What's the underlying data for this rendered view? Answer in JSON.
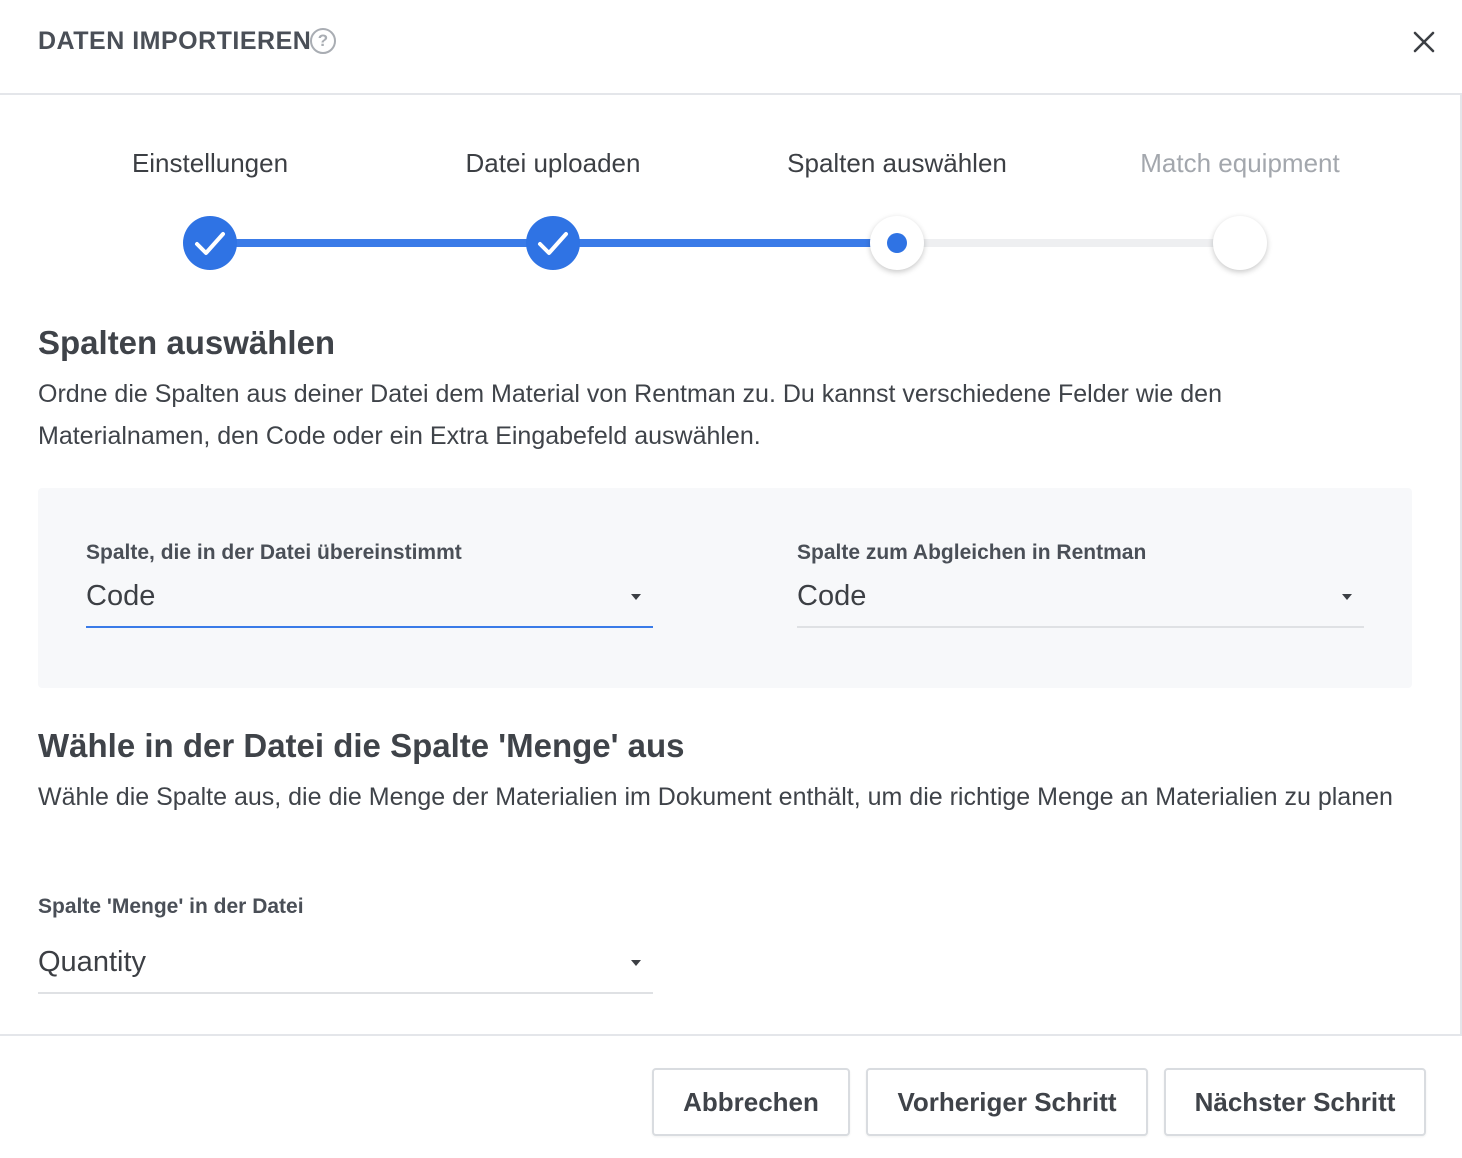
{
  "header": {
    "title": "DATEN IMPORTIEREN",
    "help_icon": "question-circle-icon",
    "help_glyph": "?",
    "close_icon": "close-icon"
  },
  "stepper": {
    "steps": [
      {
        "label": "Einstellungen",
        "state": "done"
      },
      {
        "label": "Datei uploaden",
        "state": "done"
      },
      {
        "label": "Spalten auswählen",
        "state": "current"
      },
      {
        "label": "Match equipment",
        "state": "todo"
      }
    ]
  },
  "section_columns": {
    "heading": "Spalten auswählen",
    "description": "Ordne die Spalten aus deiner Datei dem Material von Rentman zu. Du kannst verschiedene Felder wie den Materialnamen, den Code oder ein Extra Eingabefeld auswählen.",
    "file_column": {
      "label": "Spalte, die in der Datei übereinstimmt",
      "value": "Code"
    },
    "rentman_column": {
      "label": "Spalte zum Abgleichen in Rentman",
      "value": "Code"
    }
  },
  "section_quantity": {
    "heading": "Wähle in der Datei die Spalte 'Menge' aus",
    "description": "Wähle die Spalte aus, die die Menge der Materialien im Dokument enthält, um die richtige Menge an Materialien zu planen",
    "quantity_column": {
      "label": "Spalte 'Menge' in der Datei",
      "value": "Quantity"
    }
  },
  "footer": {
    "cancel_label": "Abbrechen",
    "previous_label": "Vorheriger Schritt",
    "next_label": "Nächster Schritt"
  },
  "colors": {
    "accent": "#2f73e4",
    "inactive_text": "#a3a7ad",
    "panel_background": "#f7f8fa"
  }
}
